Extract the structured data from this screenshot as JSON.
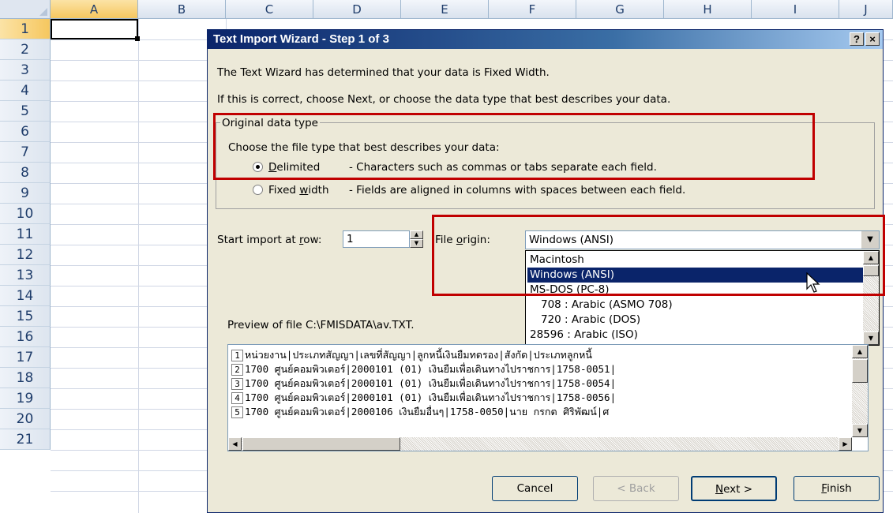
{
  "sheet": {
    "columns": [
      "A",
      "B",
      "C",
      "D",
      "E",
      "F",
      "G",
      "H",
      "I",
      "J"
    ],
    "rows": [
      "1",
      "2",
      "3",
      "4",
      "5",
      "6",
      "7",
      "8",
      "9",
      "10",
      "11",
      "12",
      "13",
      "14",
      "15",
      "16",
      "17",
      "18",
      "19",
      "20",
      "21"
    ]
  },
  "dialog": {
    "title": "Text Import Wizard - Step 1 of 3",
    "help_btn": "?",
    "close_btn": "×",
    "intro_line1": "The Text Wizard has determined that your data is Fixed Width.",
    "intro_line2": "If this is correct, choose Next, or choose the data type that best describes your data.",
    "group_label": "Original data type",
    "choose_text": "Choose the file type that best describes your data:",
    "radio_delimited": {
      "label_u": "D",
      "label_rest": "elimited",
      "desc": "- Characters such as commas or tabs separate each field.",
      "checked": true
    },
    "radio_fixed": {
      "label_pre": "Fixed ",
      "label_u": "w",
      "label_rest": "idth",
      "desc": "- Fields are aligned in columns with spaces between each field.",
      "checked": false
    },
    "start_row_label_pre": "Start import at ",
    "start_row_label_u": "r",
    "start_row_label_rest": "ow:",
    "start_row_value": "1",
    "file_origin_label_pre": "File ",
    "file_origin_label_u": "o",
    "file_origin_label_rest": "rigin:",
    "file_origin_value": "Windows (ANSI)",
    "file_origin_options": [
      "Macintosh",
      "Windows (ANSI)",
      "MS-DOS (PC-8)",
      "708 : Arabic (ASMO 708)",
      "720 : Arabic (DOS)",
      "28596 : Arabic (ISO)"
    ],
    "preview_label": "Preview of file C:\\FMISDATA\\av.TXT.",
    "preview_lines": [
      {
        "num": "1",
        "text": "หน่วยงาน|ประเภทสัญญา|เลขที่สัญญา|ลูกหนี้เงินยืมทดรอง|สังกัด|ประเภทลูกหนี้"
      },
      {
        "num": "2",
        "text": "1700 ศูนย์คอมพิวเตอร์|2000101 (01) เงินยืมเพื่อเดินทางไปราชการ|1758-0051|"
      },
      {
        "num": "3",
        "text": "1700 ศูนย์คอมพิวเตอร์|2000101 (01) เงินยืมเพื่อเดินทางไปราชการ|1758-0054|"
      },
      {
        "num": "4",
        "text": "1700 ศูนย์คอมพิวเตอร์|2000101 (01) เงินยืมเพื่อเดินทางไปราชการ|1758-0056|"
      },
      {
        "num": "5",
        "text": "1700 ศูนย์คอมพิวเตอร์|2000106 เงินยืมอื่นๆ|1758-0050|นาย กรกต ศิริพัฒน์|ศ"
      }
    ],
    "buttons": {
      "cancel": "Cancel",
      "back": "< Back",
      "next_u": "N",
      "next_rest": "ext >",
      "finish_u": "F",
      "finish_rest": "inish"
    }
  },
  "colors": {
    "highlight_box": "#c00000",
    "titlebar": "#0a246a",
    "selection": "#0a246a"
  }
}
